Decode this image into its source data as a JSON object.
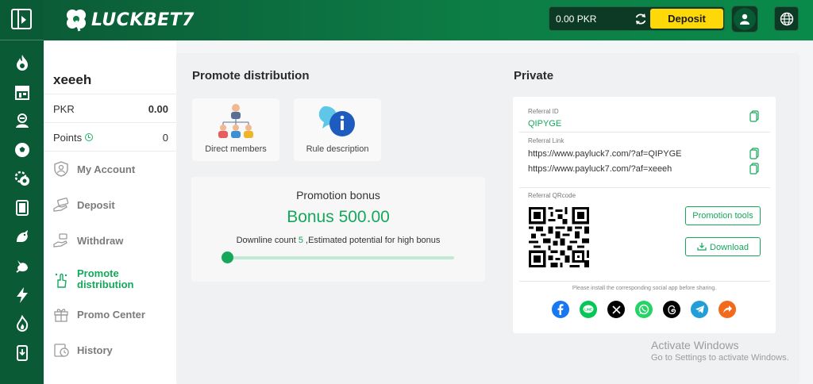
{
  "header": {
    "logo_text": "LUCKBET7",
    "balance": "0.00 PKR",
    "deposit_label": "Deposit"
  },
  "rail": {
    "icons": [
      "fire-icon",
      "store-icon",
      "live-dealer-icon",
      "soccer-ball-icon",
      "chips-icon",
      "cards-icon",
      "rooster-icon",
      "fighting-cock-icon",
      "lightning-icon",
      "flame-icon",
      "download-app-icon"
    ]
  },
  "account": {
    "username": "xeeeh",
    "currency_label": "PKR",
    "currency_value": "0.00",
    "points_label": "Points",
    "points_value": "0",
    "menu": [
      {
        "label": "My Account",
        "icon": "user-shield-icon"
      },
      {
        "label": "Deposit",
        "icon": "deposit-hand-icon"
      },
      {
        "label": "Withdraw",
        "icon": "withdraw-hand-icon"
      },
      {
        "label": "Promote distribution",
        "icon": "promote-hand-icon",
        "active": true
      },
      {
        "label": "Promo Center",
        "icon": "gift-icon"
      },
      {
        "label": "History",
        "icon": "history-icon"
      }
    ]
  },
  "promote": {
    "title": "Promote distribution",
    "direct_members_label": "Direct members",
    "rule_description_label": "Rule description",
    "bonus_label": "Promotion bonus",
    "bonus_value": "Bonus 500.00",
    "downline_prefix": "Downline count",
    "downline_count": "5",
    "downline_suffix": ",Estimated potential for high bonus",
    "progress_fraction": 0.0
  },
  "private": {
    "title": "Private",
    "referral_id_label": "Referral ID",
    "referral_id": "QIPYGE",
    "referral_link_label": "Referral Link",
    "link_1": "https://www.payluck7.com/?af=QIPYGE",
    "link_2": "https://www.payluck7.com/?af=xeeeh",
    "qr_label": "Referral QRcode",
    "promotion_tools_label": "Promotion tools",
    "download_label": "Download",
    "share_note": "Please install the corresponding social app before sharing.",
    "social": [
      "facebook-icon",
      "line-icon",
      "x-icon",
      "whatsapp-icon",
      "threads-icon",
      "telegram-icon",
      "share-icon"
    ]
  },
  "watermark": {
    "line1": "Activate Windows",
    "line2": "Go to Settings to activate Windows."
  },
  "colors": {
    "brand_green": "#15a85b",
    "header_dark": "#0b5c37",
    "deposit_yellow": "#ffd80a",
    "rail_bg": "#0a5a36"
  }
}
